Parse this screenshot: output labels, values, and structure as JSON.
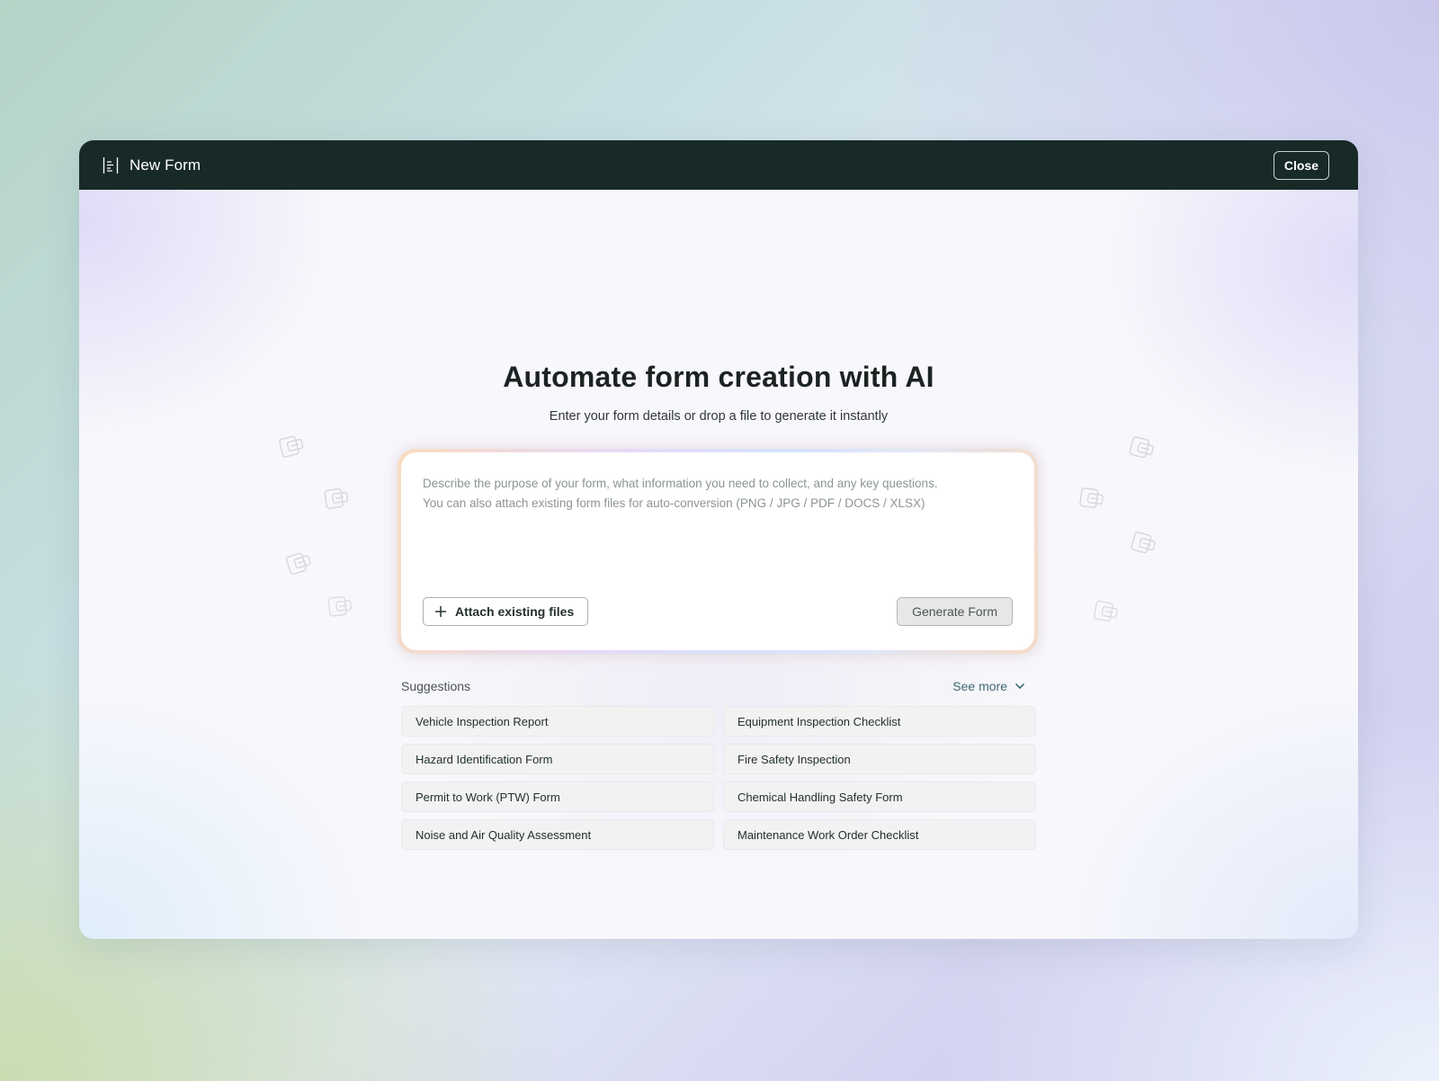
{
  "window": {
    "title": "New Form",
    "close_label": "Close"
  },
  "hero": {
    "title": "Automate form creation with AI",
    "subtitle": "Enter your form details or drop a file to generate it instantly"
  },
  "prompt": {
    "placeholder_line1": "Describe the purpose of your form, what information you need to collect, and any key questions.",
    "placeholder_line2": "You can also attach existing form files for auto-conversion (PNG / JPG / PDF / DOCS / XLSX)",
    "attach_label": "Attach existing files",
    "generate_label": "Generate Form"
  },
  "suggestions": {
    "label": "Suggestions",
    "see_more_label": "See more",
    "items": [
      "Vehicle Inspection Report",
      "Equipment Inspection Checklist",
      "Hazard Identification Form",
      "Fire Safety Inspection",
      "Permit to Work (PTW) Form",
      "Chemical Handling Safety Form",
      "Noise and Air Quality Assessment",
      "Maintenance Work Order Checklist"
    ]
  },
  "icons": {
    "titlebar": "form-document-icon",
    "attach": "plus-icon",
    "see_more": "chevron-down-icon",
    "decorative": "form-card-icon"
  },
  "colors": {
    "titlebar_bg": "#182a28",
    "accent_link": "#3e6b72",
    "chip_bg": "#f2f2f3"
  }
}
